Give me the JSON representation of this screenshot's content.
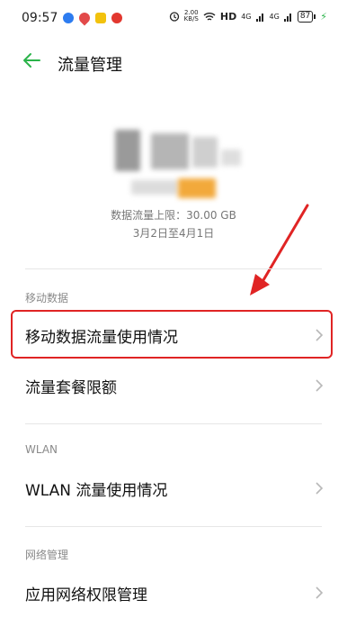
{
  "status_bar": {
    "time": "09:57",
    "net_speed_value": "2.00",
    "net_speed_unit": "KB/S",
    "hd": "HD",
    "signal1": "4G",
    "signal2": "4G",
    "battery": "87"
  },
  "header": {
    "title": "流量管理"
  },
  "usage": {
    "limit_text": "数据流量上限：30.00 GB",
    "period_text": "3月2日至4月1日"
  },
  "sections": {
    "mobile_data": {
      "label": "移动数据",
      "items": [
        "移动数据流量使用情况",
        "流量套餐限额"
      ]
    },
    "wlan": {
      "label": "WLAN",
      "items": [
        "WLAN 流量使用情况"
      ]
    },
    "network": {
      "label": "网络管理",
      "items": [
        "应用网络权限管理"
      ]
    }
  },
  "colors": {
    "accent": "#2bb34a",
    "highlight": "#e02424",
    "progress_fill": "#f2a93b"
  }
}
